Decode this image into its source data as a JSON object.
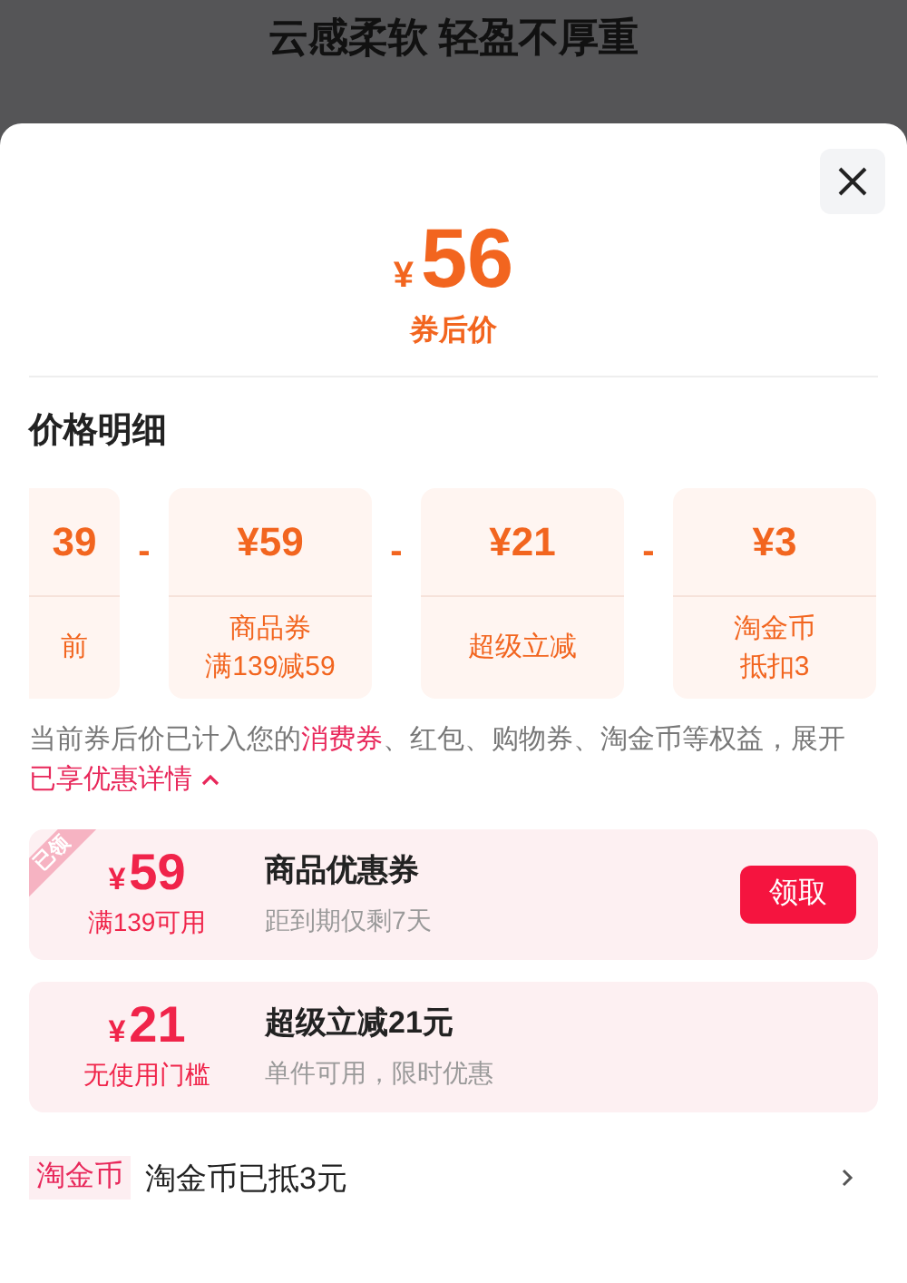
{
  "background": {
    "title": "云感柔软 轻盈不厚重"
  },
  "price": {
    "currency": "¥",
    "amount": "56",
    "label": "券后价"
  },
  "breakdown": {
    "title": "价格明细",
    "items": [
      {
        "kind": "partial",
        "amount": "39",
        "lines": [
          "前"
        ]
      },
      {
        "kind": "full",
        "operator": "-",
        "amount": "¥59",
        "lines": [
          "商品券",
          "满139减59"
        ]
      },
      {
        "kind": "full",
        "operator": "-",
        "amount": "¥21",
        "lines": [
          "超级立减"
        ]
      },
      {
        "kind": "full",
        "operator": "-",
        "amount": "¥3",
        "lines": [
          "淘金币",
          "抵扣3"
        ]
      }
    ]
  },
  "note": [
    {
      "kind": "text",
      "text": "当前券后价已计入您的"
    },
    {
      "kind": "link",
      "text": "消费券"
    },
    {
      "kind": "text",
      "text": "、红包、购物券、淘金币等权益，展开"
    },
    {
      "kind": "link",
      "text": "已享优惠详情",
      "expanded": true
    }
  ],
  "coupons": [
    {
      "currency": "¥",
      "amount": "59",
      "condition": "满139可用",
      "title": "商品优惠券",
      "subtitle": "距到期仅剩7天",
      "tag": "已领",
      "button": "领取"
    },
    {
      "currency": "¥",
      "amount": "21",
      "condition": "无使用门槛",
      "title": "超级立减21元",
      "subtitle": "单件可用，限时优惠"
    }
  ],
  "coins": {
    "tag": "淘金币",
    "text": "淘金币已抵3元"
  }
}
